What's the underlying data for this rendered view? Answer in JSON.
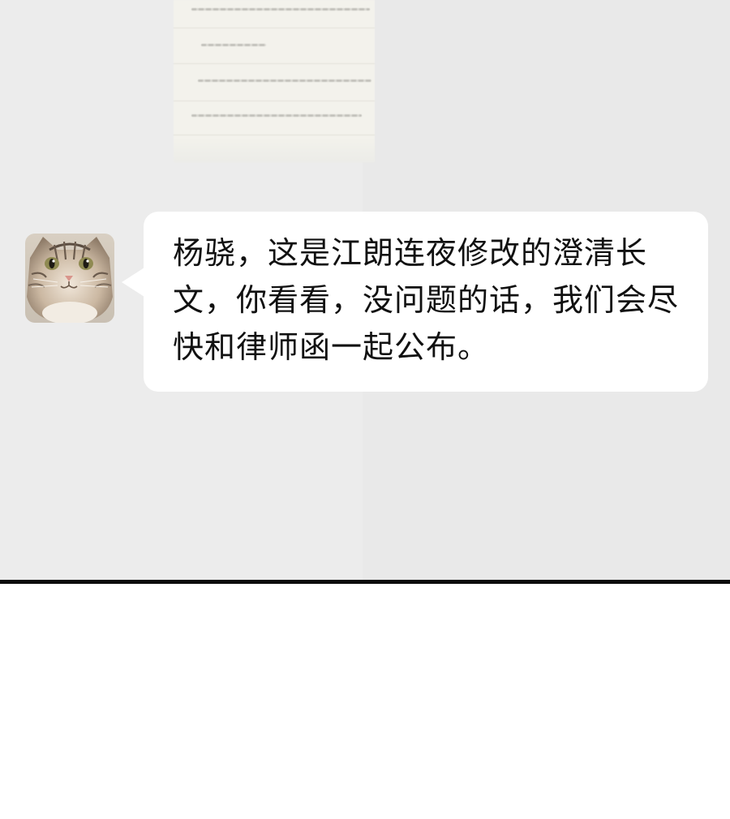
{
  "conversation": {
    "incoming_message": {
      "sender_avatar": "cat-avatar-icon",
      "text": "杨骁，这是江朗连夜修改的澄清长文，你看看，没问题的话，我们会尽快和律师函一起公布。"
    },
    "attachment_preview": {
      "type": "blurred-document-image"
    }
  },
  "colors": {
    "chat_background": "#ececec",
    "bubble_background": "#ffffff",
    "message_text": "#111111",
    "divider": "#0b0b0b",
    "page_background": "#ffffff"
  }
}
